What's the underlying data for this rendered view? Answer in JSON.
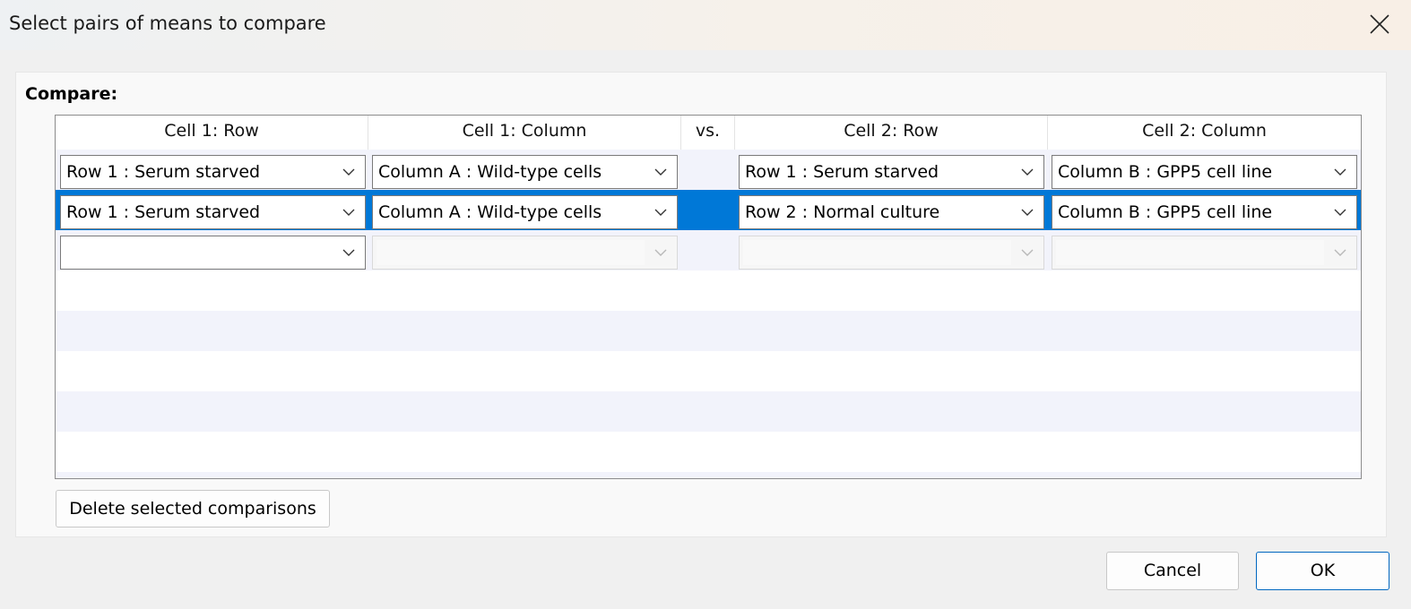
{
  "window": {
    "title": "Select pairs of means to compare",
    "close_icon": "close-icon"
  },
  "compare_label": "Compare:",
  "grid": {
    "headers": [
      "Cell 1: Row",
      "Cell 1: Column",
      "vs.",
      "Cell 2: Row",
      "Cell 2: Column"
    ],
    "rows": [
      {
        "cell1_row": "Row 1 : Serum starved",
        "cell1_col": "Column A : Wild-type cells",
        "cell2_row": "Row 1 : Serum starved",
        "cell2_col": "Column B : GPP5 cell line",
        "selected": false
      },
      {
        "cell1_row": "Row 1 : Serum starved",
        "cell1_col": "Column A : Wild-type cells",
        "cell2_row": "Row 2 : Normal culture",
        "cell2_col": "Column B : GPP5 cell line",
        "selected": true
      },
      {
        "cell1_row": "",
        "cell1_col": "",
        "cell2_row": "",
        "cell2_col": "",
        "selected": false
      }
    ]
  },
  "buttons": {
    "delete": "Delete selected comparisons",
    "cancel": "Cancel",
    "ok": "OK"
  },
  "colors": {
    "selection": "#0078d7",
    "alt_row": "#f2f3fb",
    "ok_border": "#0067c0"
  }
}
